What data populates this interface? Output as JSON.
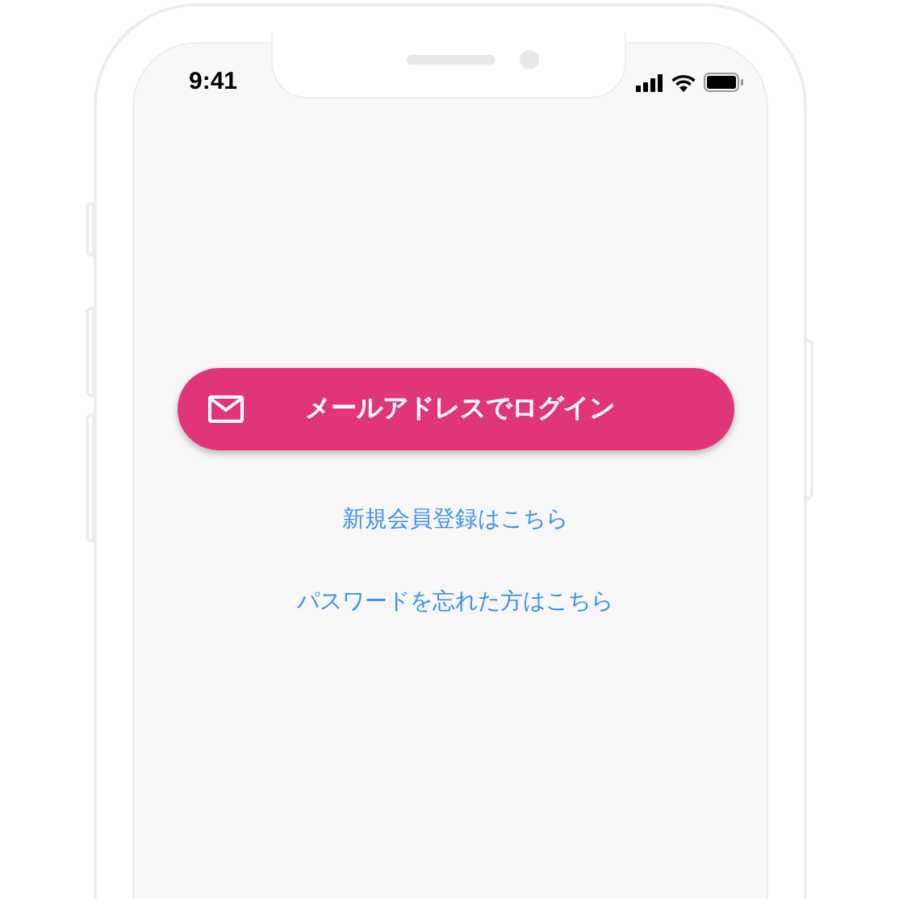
{
  "status_bar": {
    "time": "9:41"
  },
  "login_button": {
    "label": "メールアドレスでログイン"
  },
  "links": [
    {
      "label": "新規会員登録はこちら"
    },
    {
      "label": "パスワードを忘れた方はこちら"
    }
  ]
}
